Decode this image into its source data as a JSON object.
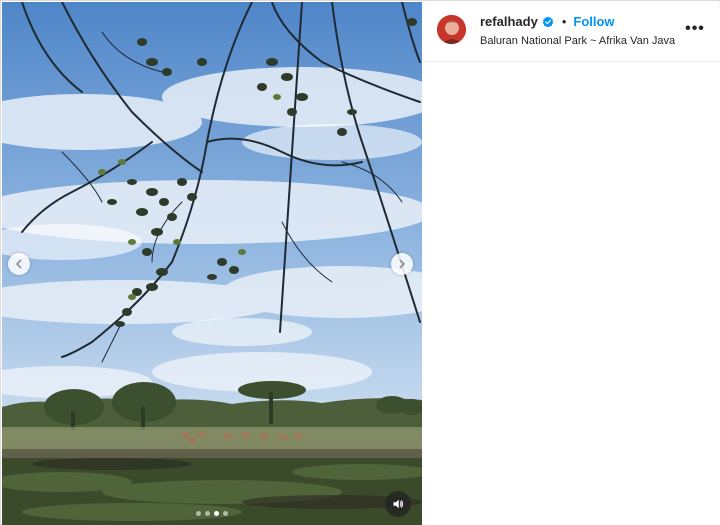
{
  "post": {
    "username": "refalhady",
    "separator": "•",
    "follow_label": "Follow",
    "location": "Baluran National Park ~ Afrika Van Java",
    "more_label": "•••",
    "verified": true
  },
  "carousel": {
    "slide_count": 4,
    "active_index": 2
  },
  "icons": {
    "prev": "chevron-left-icon",
    "next": "chevron-right-icon",
    "audio": "speaker-icon",
    "verified": "verified-badge-icon",
    "more": "more-options-icon"
  },
  "colors": {
    "accent": "#0095f6",
    "text": "#262626",
    "border": "#dbdbdb"
  }
}
